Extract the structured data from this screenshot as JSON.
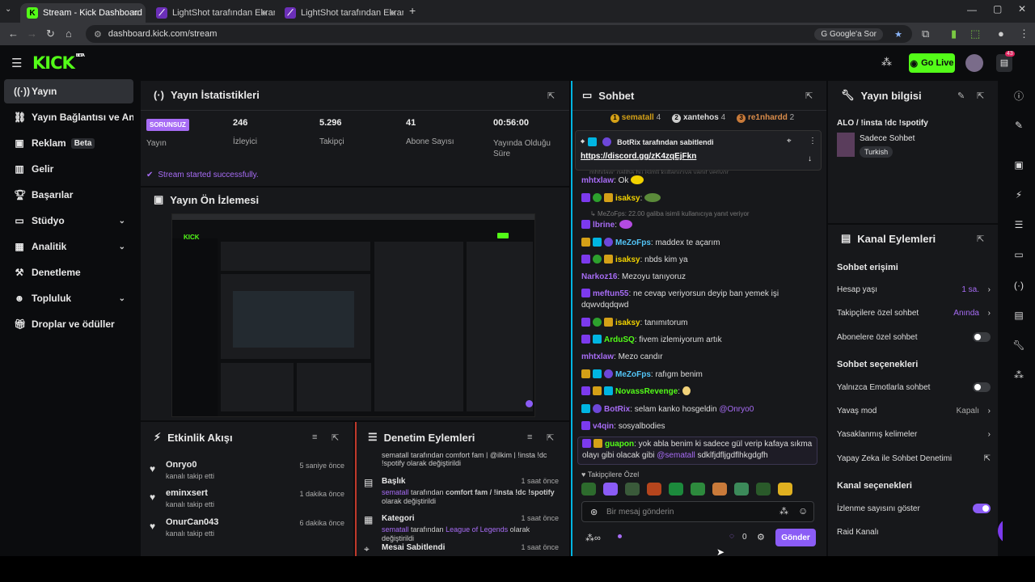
{
  "browser": {
    "tabs": [
      {
        "title": "Stream - Kick Dashboard",
        "active": true
      },
      {
        "title": "LightShot tarafından Ekran Gör",
        "active": false
      },
      {
        "title": "LightShot tarafından Ekran Gör",
        "active": false
      }
    ],
    "url": "dashboard.kick.com/stream",
    "google_label": "Google'a Sor"
  },
  "header": {
    "go_live_label": "Go Live",
    "logo": "KICK",
    "logo_tag": "BETA",
    "notif_count": "43"
  },
  "sidebar": {
    "items": [
      {
        "label": "Yayın",
        "icon": "broadcast-icon",
        "active": true
      },
      {
        "label": "Yayın Bağlantısı ve Anahtar",
        "icon": "link-icon"
      },
      {
        "label": "Reklam",
        "icon": "ad-icon",
        "badge": "Beta"
      },
      {
        "label": "Gelir",
        "icon": "revenue-icon"
      },
      {
        "label": "Başarılar",
        "icon": "trophy-icon"
      },
      {
        "label": "Stüdyo",
        "icon": "studio-icon",
        "chevron": true
      },
      {
        "label": "Analitik",
        "icon": "analytics-icon",
        "chevron": true
      },
      {
        "label": "Denetleme",
        "icon": "hammer-icon"
      },
      {
        "label": "Topluluk",
        "icon": "community-icon",
        "chevron": true
      },
      {
        "label": "Droplar ve ödüller",
        "icon": "gift-icon"
      }
    ]
  },
  "stats": {
    "title": "Yayın İstatistikleri",
    "status_badge": "SORUNSUZ",
    "status_label": "Yayın",
    "items": [
      {
        "value": "246",
        "label": "İzleyici"
      },
      {
        "value": "5.296",
        "label": "Takipçi"
      },
      {
        "value": "41",
        "label": "Abone Sayısı"
      },
      {
        "value": "00:56:00",
        "label": "Yayında Olduğu Süre"
      }
    ],
    "success_msg": "Stream started successfully."
  },
  "preview": {
    "title": "Yayın Ön İzlemesi"
  },
  "activity": {
    "title": "Etkinlik Akışı",
    "items": [
      {
        "name": "Onryo0",
        "sub": "kanalı takip etti",
        "time": "5 saniye önce"
      },
      {
        "name": "eminxsert",
        "sub": "kanalı takip etti",
        "time": "1 dakika önce"
      },
      {
        "name": "OnurCan043",
        "sub": "kanalı takip etti",
        "time": "6 dakika önce"
      }
    ]
  },
  "moderation": {
    "title": "Denetim Eylemleri",
    "top_fragment_1": "sematall tarafından comfort fam | @ilkim | !insta !dc",
    "top_fragment_2": "!spotify olarak değiştirildi",
    "items": [
      {
        "icon": "title-icon",
        "title": "Başlık",
        "time": "1 saat önce",
        "user": "sematall",
        "mid": " tarafından ",
        "value": "comfort fam / !insta !dc !spotify",
        "tail": " olarak değiştirildi"
      },
      {
        "icon": "category-icon",
        "title": "Kategori",
        "time": "1 saat önce",
        "user": "sematall",
        "mid": " tarafından ",
        "value": "League of Legends",
        "tail": " olarak değiştirildi"
      },
      {
        "icon": "pin-icon",
        "title": "Mesai Sabitlendi",
        "time": "1 saat önce"
      }
    ]
  },
  "chat": {
    "title": "Sohbet",
    "top_gifters": [
      {
        "rank": "1",
        "name": "sematall",
        "count": "4"
      },
      {
        "rank": "2",
        "name": "xantehos",
        "count": "4"
      },
      {
        "rank": "3",
        "name": "re1nhardd",
        "count": "2"
      }
    ],
    "pinned": {
      "by": "BotRix tarafından sabitlendi",
      "link": "https://discord.gg/zK4zqEjFkn",
      "under": "mhtxlaw: galiba bu isimli kullanıcıya yanıt veriyor"
    },
    "messages": [
      {
        "user": "mhtxlaw",
        "color": "#a76cf5",
        "text": "Ok",
        "badges": [],
        "emote": "#f2d200"
      },
      {
        "user": "isaksy",
        "color": "#f2d200",
        "text": "",
        "badges": [
          "b-sub",
          "b-og",
          "b-gold"
        ],
        "emote": "#5b8a3a"
      },
      {
        "reply": "MeZoFps: 22.00 galiba isimli kullanıcıya yanıt veriyor"
      },
      {
        "user": "lbrine",
        "color": "#a76cf5",
        "text": "",
        "badges": [
          "b-sub"
        ],
        "emote": "#b44be1"
      },
      {
        "user": "MeZoFps",
        "color": "#53c5f7",
        "text": "maddex te açarım",
        "badges": [
          "b-gold",
          "b-mod",
          "b-ver"
        ]
      },
      {
        "user": "isaksy",
        "color": "#f2d200",
        "text": "nbds kim ya",
        "badges": [
          "b-sub",
          "b-og",
          "b-gold"
        ]
      },
      {
        "user": "Narkoz16",
        "color": "#a76cf5",
        "text": "Mezoyu tanıyoruz",
        "badges": []
      },
      {
        "user": "meftun55",
        "color": "#a76cf5",
        "text": "ne cevap veriyorsun deyip ban yemek işi dqwvdqdqwd",
        "badges": [
          "b-sub"
        ]
      },
      {
        "user": "isaksy",
        "color": "#f2d200",
        "text": "tanımıtorum",
        "badges": [
          "b-sub",
          "b-og",
          "b-gold"
        ]
      },
      {
        "user": "ArduSQ",
        "color": "#53fc18",
        "text": "fivem izlemiyorum artık",
        "badges": [
          "b-sub",
          "b-mod"
        ]
      },
      {
        "user": "mhtxlaw",
        "color": "#a76cf5",
        "text": "Mezo candır",
        "badges": []
      },
      {
        "user": "MeZoFps",
        "color": "#53c5f7",
        "text": "rafıgm benim",
        "badges": [
          "b-gold",
          "b-mod",
          "b-ver"
        ]
      },
      {
        "user": "NovassRevenge",
        "color": "#53fc18",
        "text": "",
        "badges": [
          "b-sub",
          "b-gold",
          "b-mod"
        ],
        "emote": "#f2d27a"
      },
      {
        "user": "BotRix",
        "color": "#a76cf5",
        "text": "selam kanko hosgeldin",
        "mention": "@Onryo0",
        "badges": [
          "b-mod",
          "b-ver"
        ]
      },
      {
        "user": "v4qin",
        "color": "#a76cf5",
        "text": "sosyalbodies",
        "badges": [
          "b-sub"
        ]
      },
      {
        "user": "guapon",
        "color": "#53fc18",
        "text": "yok abla benim ki sadece gül verip kafaya sıkma olayı gibi olacak gibi",
        "mention": "@sematall",
        "tail": "sdklfjdfljgdflhkgdgfh",
        "badges": [
          "b-sub",
          "b-gold"
        ]
      }
    ],
    "follower_label": "Takipçilere Özel",
    "input_placeholder": "Bir mesaj gönderin",
    "points": "0",
    "send_label": "Gönder",
    "emotes": [
      "#2d6b2d",
      "#8b5cf6",
      "#3a5a3a",
      "#b5451d",
      "#1c8a3c",
      "#2d8a3d",
      "#c97a3a",
      "#3c8a5a",
      "#2a5a2a",
      "#e0b020"
    ]
  },
  "info": {
    "title": "Yayın bilgisi",
    "stream_title": "ALO / !insta !dc !spotify",
    "mode": "Sadece Sohbet",
    "language": "Turkish"
  },
  "channel": {
    "title": "Kanal Eylemleri",
    "access_title": "Sohbet erişimi",
    "access": [
      {
        "label": "Hesap yaşı",
        "value": "1 sa.",
        "type": "link"
      },
      {
        "label": "Takipçilere özel sohbet",
        "value": "Anında",
        "type": "link"
      },
      {
        "label": "Abonelere özel sohbet",
        "type": "toggle",
        "on": false
      }
    ],
    "options_title": "Sohbet seçenekleri",
    "options": [
      {
        "label": "Yalnızca Emotlarla sohbet",
        "type": "toggle",
        "on": false
      },
      {
        "label": "Yavaş mod",
        "value": "Kapalı",
        "type": "link"
      },
      {
        "label": "Yasaklanmış kelimeler",
        "type": "link"
      },
      {
        "label": "Yapay Zeka ile Sohbet Denetimi",
        "type": "ext"
      }
    ],
    "chan_title": "Kanal seçenekleri",
    "chan": [
      {
        "label": "İzlenme sayısını göster",
        "type": "toggle",
        "on": true
      },
      {
        "label": "Raid Kanalı",
        "type": "plain"
      }
    ]
  },
  "colors": {
    "brand": "#53fc18",
    "accent": "#8b5cf6",
    "bg": "#0b0c0e",
    "panel": "#17181b"
  }
}
